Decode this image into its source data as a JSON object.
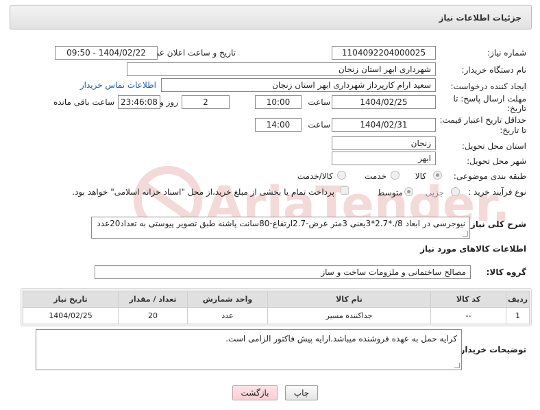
{
  "header": {
    "title": "جزئیات اطلاعات نیاز"
  },
  "fields": {
    "need_number_label": "شماره نیاز:",
    "need_number_value": "1104092204000025",
    "announce_label": "تاریخ و ساعت اعلان عمومی:",
    "announce_value": "1404/02/22 - 09:50",
    "buyer_org_label": "نام دستگاه خریدار:",
    "buyer_org_value": "شهرداری ابهر استان زنجان",
    "creator_label": "ایجاد کننده درخواست:",
    "creator_value": "سعید ارام کارپرداز  شهرداری ابهر استان زنجان",
    "contact_link": "اطلاعات تماس خریدار",
    "deadline_label_1": "مهلت ارسال پاسخ: تا",
    "deadline_label_2": "تاریخ:",
    "deadline_date": "1404/02/25",
    "time_label": "ساعت",
    "deadline_time": "10:00",
    "days_value": "2",
    "days_label": "روز و",
    "remaining_time": "23:46:08",
    "remaining_label": "ساعت باقی مانده",
    "validity_label_1": "حداقل تاریخ اعتبار قیمت:",
    "validity_label_2": "تا تاریخ:",
    "validity_date": "1404/02/31",
    "validity_time_label": "ساعت",
    "validity_time": "14:00",
    "province_label": "استان محل تحویل:",
    "province_value": "زنجان",
    "city_label": "شهر محل تحویل:",
    "city_value": "ابهر",
    "category_label": "طبقه بندی موضوعی:",
    "category_options": [
      "کالا",
      "خدمت",
      "کالا/خدمت"
    ],
    "process_label": "نوع فرآیند خرید :",
    "process_options": [
      "جزیی",
      "متوسط"
    ],
    "payment_note": "پرداخت تمام یا بخشی از مبلغ خرید،از محل \"اسناد خزانه اسلامی\" خواهد بود."
  },
  "description": {
    "label": "شرح کلی نیاز:",
    "value": "نیوجرسی در ابعاد 8/.*2.7*3یعنی 3متر عرض-2.7ارتفاع-80سانت پاشنه طبق تصویر پیوستی به تعداد20عدد"
  },
  "goods_info_title": "اطلاعات کالاهای مورد نیاز",
  "goods_group": {
    "label": "گروه کالا:",
    "value": "مصالح ساختمانی و ملزومات ساخت و ساز"
  },
  "table": {
    "headers": [
      "ردیف",
      "کد کالا",
      "نام کالا",
      "واحد شمارش",
      "تعداد / مقدار",
      "تاریخ نیاز"
    ],
    "rows": [
      {
        "row": "1",
        "code": "--",
        "name": "جداکننده مسیر",
        "unit": "عدد",
        "qty": "20",
        "date": "1404/02/25"
      }
    ]
  },
  "buyer_notes": {
    "label": "توضیحات خریدار:",
    "value": "کرایه حمل به عهده فروشنده میباشد.ارایه پیش فاکتور الزامی است."
  },
  "buttons": {
    "print": "چاپ",
    "back": "بازگشت"
  },
  "watermark_text": "AriaTender.neT",
  "colors": {
    "link": "#1a5bb5",
    "header_bg": "#e8e8e8",
    "back_button": "#f8cfd4",
    "watermark": "#c0392b"
  }
}
